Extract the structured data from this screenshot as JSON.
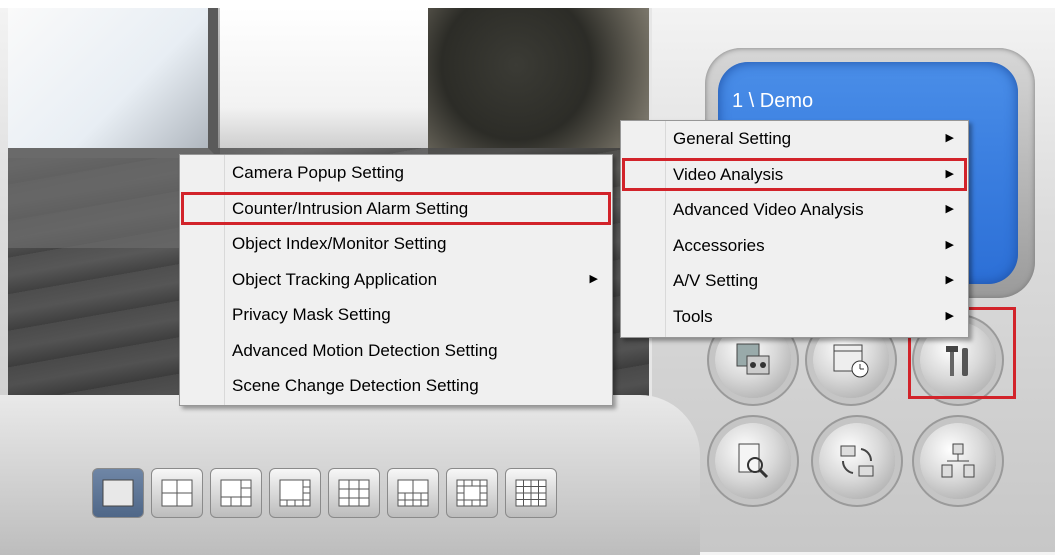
{
  "app": {
    "lcd_title": "1 \\ Demo"
  },
  "main_menu": {
    "items": [
      {
        "label": "General Setting",
        "has_submenu": true
      },
      {
        "label": "Video Analysis",
        "has_submenu": true
      },
      {
        "label": "Advanced Video Analysis",
        "has_submenu": true
      },
      {
        "label": "Accessories",
        "has_submenu": true
      },
      {
        "label": "A/V Setting",
        "has_submenu": true
      },
      {
        "label": "Tools",
        "has_submenu": true
      }
    ]
  },
  "video_analysis_menu": {
    "items": [
      {
        "label": "Camera Popup Setting",
        "has_submenu": false
      },
      {
        "label": "Counter/Intrusion Alarm Setting",
        "has_submenu": false
      },
      {
        "label": "Object Index/Monitor Setting",
        "has_submenu": false
      },
      {
        "label": "Object Tracking Application",
        "has_submenu": true
      },
      {
        "label": "Privacy Mask Setting",
        "has_submenu": false
      },
      {
        "label": "Advanced Motion Detection Setting",
        "has_submenu": false
      },
      {
        "label": "Scene Change Detection Setting",
        "has_submenu": false
      }
    ]
  },
  "control_buttons": [
    {
      "icon": "playback-icon"
    },
    {
      "icon": "schedule-icon"
    },
    {
      "icon": "tools-icon"
    },
    {
      "icon": "search-log-icon"
    },
    {
      "icon": "network-sync-icon"
    },
    {
      "icon": "remote-network-icon"
    }
  ],
  "layout_buttons": [
    {
      "icon": "layout-1-icon",
      "active": true
    },
    {
      "icon": "layout-4-icon"
    },
    {
      "icon": "layout-6-icon"
    },
    {
      "icon": "layout-8-icon"
    },
    {
      "icon": "layout-9-icon"
    },
    {
      "icon": "layout-10-icon"
    },
    {
      "icon": "layout-13-icon"
    },
    {
      "icon": "layout-16-icon"
    }
  ],
  "colors": {
    "highlight_box": "#d2232a",
    "lcd_blue": "#3b7fe0",
    "menu_bg": "#f0f0f0"
  }
}
